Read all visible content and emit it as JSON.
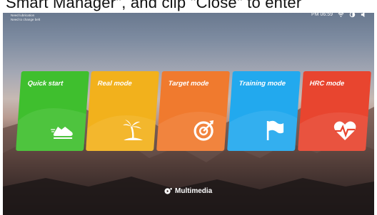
{
  "overlay_caption": "Smart Manager\", and clip \"Close\" to enter",
  "status": {
    "notification_title": "Need lubrication",
    "notification_sub": "Need to change belt",
    "time": "PM 06:59"
  },
  "modes": [
    {
      "label": "Quick start",
      "color": "#3fbf2e",
      "icon": "shoe-icon"
    },
    {
      "label": "Real mode",
      "color": "#f2b11c",
      "icon": "palm-island-icon"
    },
    {
      "label": "Target mode",
      "color": "#f07a2e",
      "icon": "target-icon"
    },
    {
      "label": "Training mode",
      "color": "#22a9ee",
      "icon": "flag-icon"
    },
    {
      "label": "HRC mode",
      "color": "#e8452f",
      "icon": "heart-rate-icon"
    }
  ],
  "multimedia": {
    "label": "Multimedia",
    "icon": "multimedia-icon"
  }
}
